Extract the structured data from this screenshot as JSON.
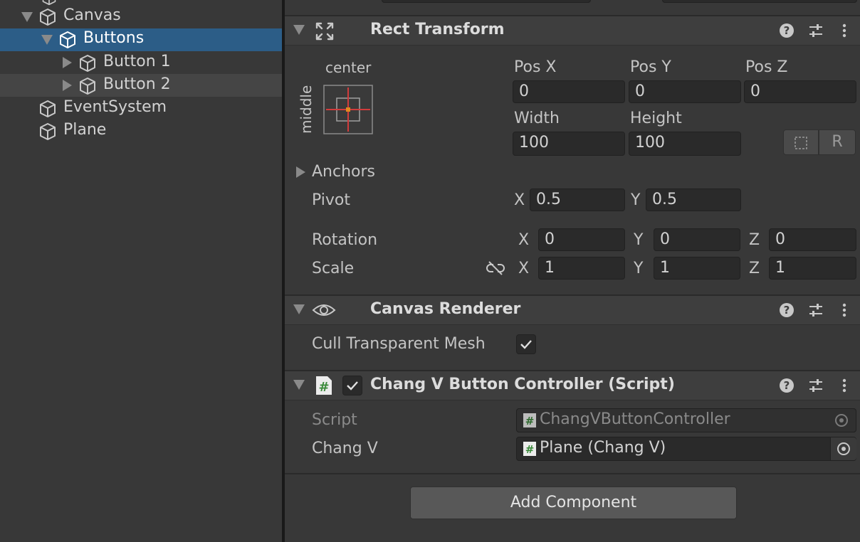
{
  "hierarchy": {
    "items": [
      {
        "label": "Canvas"
      },
      {
        "label": "Buttons"
      },
      {
        "label": "Button 1"
      },
      {
        "label": "Button 2"
      },
      {
        "label": "EventSystem"
      },
      {
        "label": "Plane"
      }
    ]
  },
  "rect_transform": {
    "title": "Rect Transform",
    "anchor_preset_top": "center",
    "anchor_preset_side": "middle",
    "pos_x_label": "Pos X",
    "pos_y_label": "Pos Y",
    "pos_z_label": "Pos Z",
    "pos_x": "0",
    "pos_y": "0",
    "pos_z": "0",
    "width_label": "Width",
    "height_label": "Height",
    "width": "100",
    "height": "100",
    "raw_edit_label": "R",
    "anchors_label": "Anchors",
    "pivot_label": "Pivot",
    "pivot_x_label": "X",
    "pivot_y_label": "Y",
    "pivot_x": "0.5",
    "pivot_y": "0.5",
    "rotation_label": "Rotation",
    "rot_x": "0",
    "rot_y": "0",
    "rot_z": "0",
    "scale_label": "Scale",
    "scale_x": "1",
    "scale_y": "1",
    "scale_z": "1",
    "x_label": "X",
    "y_label": "Y",
    "z_label": "Z"
  },
  "canvas_renderer": {
    "title": "Canvas Renderer",
    "cull_label": "Cull Transparent Mesh",
    "cull_checked": true
  },
  "script_component": {
    "title": "Chang V Button Controller (Script)",
    "enabled": true,
    "script_label": "Script",
    "script_value": "ChangVButtonController",
    "changv_label": "Chang V",
    "changv_value": "Plane (Chang V)",
    "hash_glyph": "#"
  },
  "add_component_label": "Add Component",
  "colors": {
    "selection": "#2c5d87",
    "panel": "#383838",
    "header": "#3e3e3e",
    "field": "#2a2a2a",
    "anchor_red": "#d23c3c",
    "anchor_orange": "#e08a1e",
    "script_green": "#3a8a3a"
  },
  "icons": [
    "cube-icon",
    "help-icon",
    "preset-icon",
    "menu-icon",
    "rect-transform-icon",
    "eye-icon",
    "script-icon",
    "checkmark-icon",
    "unlink-icon",
    "object-picker-icon",
    "blueprint-icon"
  ]
}
